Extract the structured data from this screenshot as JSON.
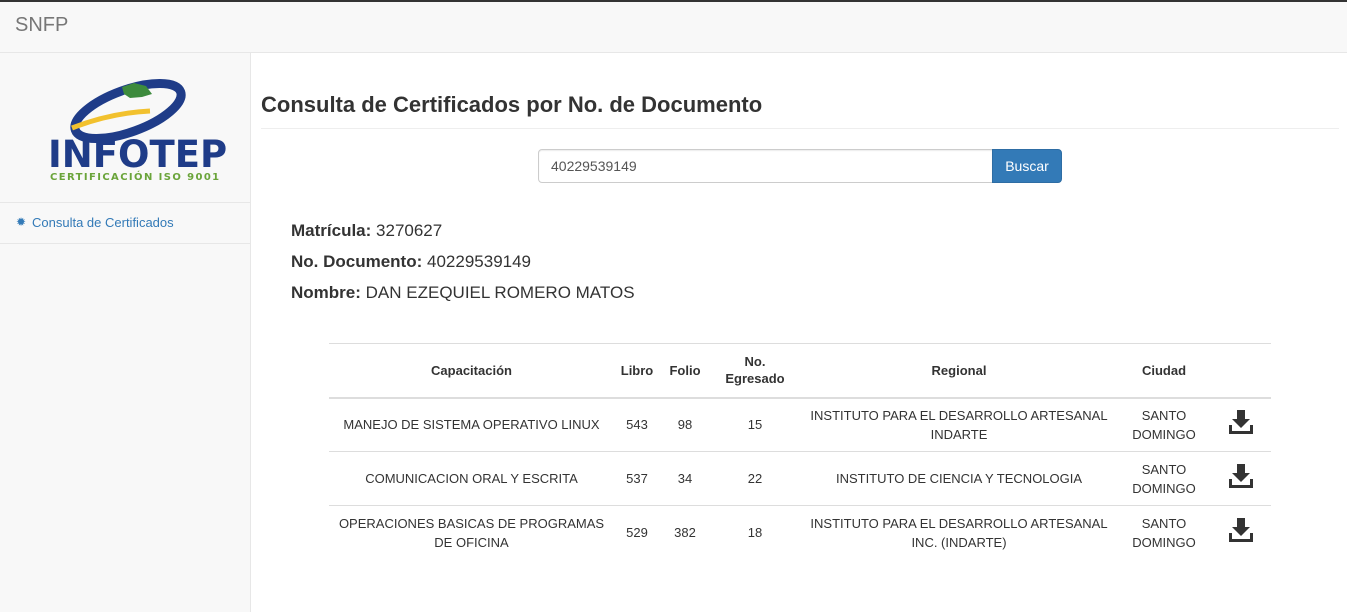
{
  "navbar": {
    "brand": "SNFP"
  },
  "sidebar": {
    "logo": {
      "word": "INFOTEP",
      "sub": "CERTIFICACIÓN ISO 9001"
    },
    "items": [
      {
        "icon": "gear-icon",
        "label": "Consulta de Certificados"
      }
    ]
  },
  "main": {
    "title": "Consulta de Certificados por No. de Documento",
    "search": {
      "value": "40229539149",
      "button": "Buscar"
    },
    "info": {
      "matricula_label": "Matrícula:",
      "matricula": "3270627",
      "documento_label": "No. Documento:",
      "documento": "40229539149",
      "nombre_label": "Nombre:",
      "nombre": "DAN EZEQUIEL ROMERO MATOS"
    },
    "table": {
      "headers": [
        "Capacitación",
        "Libro",
        "Folio",
        "No. Egresado",
        "Regional",
        "Ciudad",
        ""
      ],
      "rows": [
        {
          "capacitacion": "MANEJO DE SISTEMA OPERATIVO LINUX",
          "libro": "543",
          "folio": "98",
          "egresado": "15",
          "regional": "INSTITUTO PARA EL DESARROLLO ARTESANAL INDARTE",
          "ciudad": "SANTO DOMINGO",
          "icon": "download-icon"
        },
        {
          "capacitacion": "COMUNICACION ORAL Y ESCRITA",
          "libro": "537",
          "folio": "34",
          "egresado": "22",
          "regional": "INSTITUTO DE CIENCIA Y TECNOLOGIA",
          "ciudad": "SANTO DOMINGO",
          "icon": "download-icon"
        },
        {
          "capacitacion": "OPERACIONES BASICAS DE PROGRAMAS DE OFICINA",
          "libro": "529",
          "folio": "382",
          "egresado": "18",
          "regional": "INSTITUTO PARA EL DESARROLLO ARTESANAL INC. (INDARTE)",
          "ciudad": "SANTO DOMINGO",
          "icon": "download-icon"
        }
      ]
    }
  },
  "colors": {
    "link": "#337ab7",
    "logo_blue": "#1f3c88",
    "logo_green": "#6aa43a",
    "logo_yellow": "#f2c12e"
  }
}
